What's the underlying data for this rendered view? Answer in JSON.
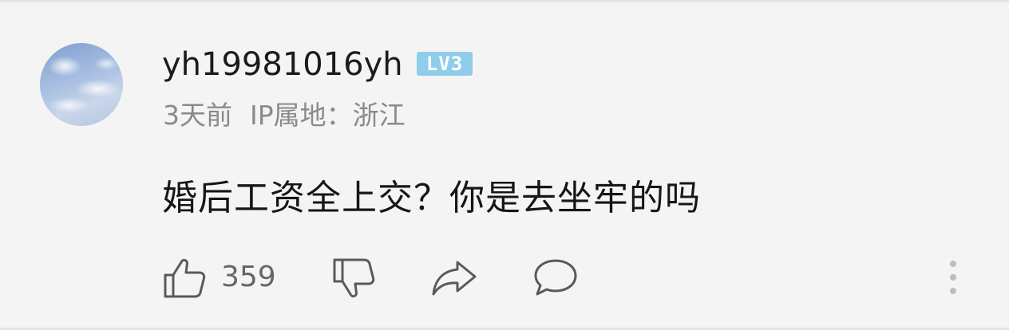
{
  "comment": {
    "username": "yh19981016yh",
    "level_badge": "LV3",
    "time_ago": "3天前",
    "ip_location": "IP属地：浙江",
    "text": "婚后工资全上交？你是去坐牢的吗",
    "like_count": "359"
  },
  "icons": {
    "avatar": "avatar-sky-clouds",
    "like": "thumbs-up-icon",
    "dislike": "thumbs-down-icon",
    "share": "share-arrow-icon",
    "reply": "speech-bubble-icon",
    "more": "more-vertical-icon"
  },
  "colors": {
    "background": "#f4f4f4",
    "username": "#1b1b1b",
    "meta": "#8a8a8a",
    "text": "#161616",
    "icon": "#5a5a5a",
    "badge": "#8fcdea"
  }
}
